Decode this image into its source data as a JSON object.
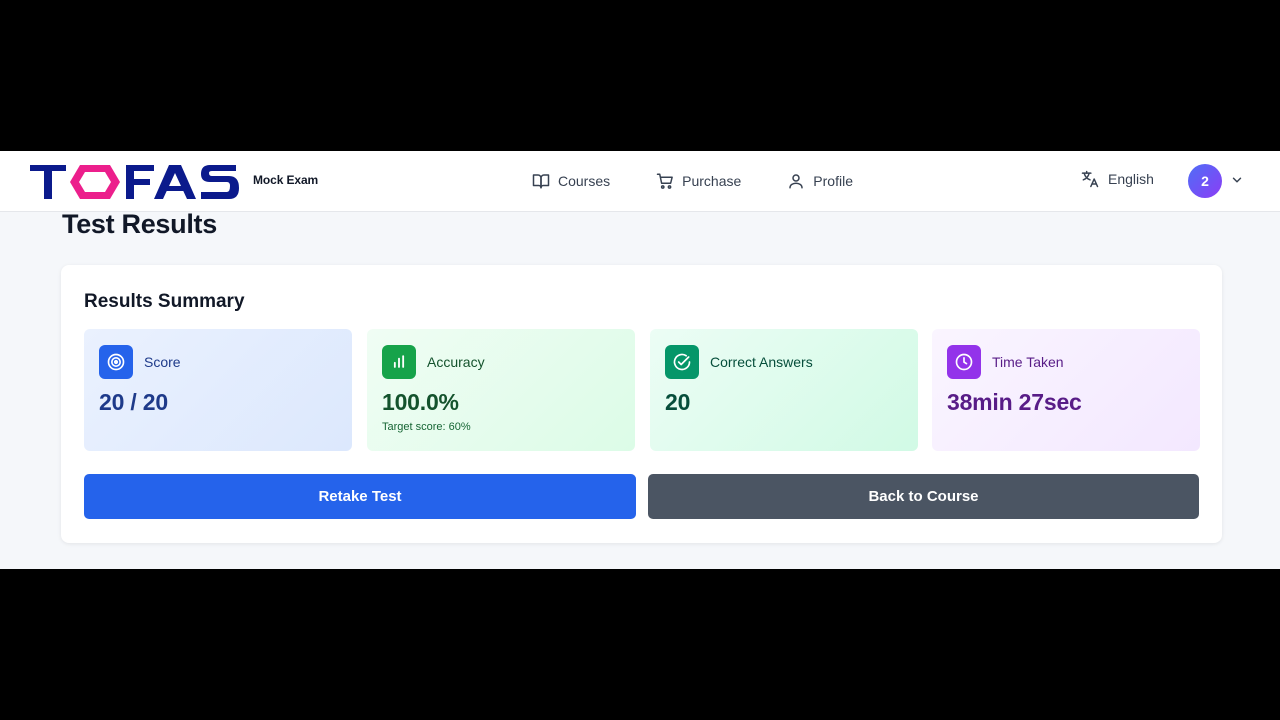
{
  "brand": {
    "logo_text": "TOFAS",
    "tagline": "Mock Exam",
    "colors": {
      "navy": "#0b1a8c",
      "pink": "#ec1f8c"
    }
  },
  "nav": {
    "items": [
      {
        "label": "Courses",
        "icon": "book-open-icon"
      },
      {
        "label": "Purchase",
        "icon": "cart-icon"
      },
      {
        "label": "Profile",
        "icon": "user-icon"
      }
    ],
    "language": {
      "label": "English",
      "icon": "translate-icon"
    },
    "avatar": {
      "initial": "2"
    }
  },
  "page": {
    "title": "Test Results"
  },
  "summary": {
    "title": "Results Summary",
    "stats": {
      "score": {
        "label": "Score",
        "value": "20 / 20",
        "icon": "target-icon",
        "color": "#2563eb"
      },
      "accuracy": {
        "label": "Accuracy",
        "value": "100.0%",
        "sub": "Target score: 60%",
        "icon": "bar-chart-icon",
        "color": "#16a34a"
      },
      "correct": {
        "label": "Correct Answers",
        "value": "20",
        "icon": "check-circle-icon",
        "color": "#059669"
      },
      "time": {
        "label": "Time Taken",
        "value": "38min 27sec",
        "icon": "clock-icon",
        "color": "#9333ea"
      }
    }
  },
  "actions": {
    "retake_label": "Retake Test",
    "back_label": "Back to Course",
    "colors": {
      "primary": "#2563eb",
      "secondary": "#4b5563"
    }
  }
}
